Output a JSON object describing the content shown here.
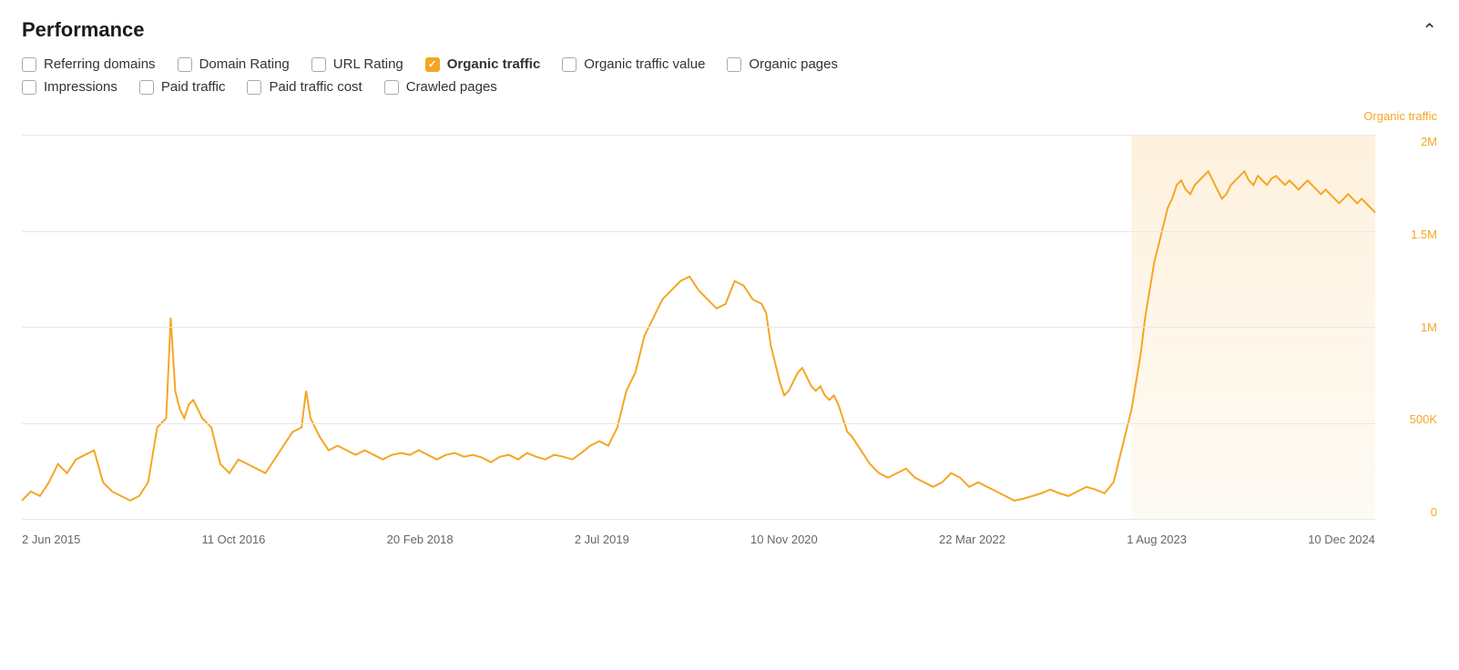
{
  "header": {
    "title": "Performance",
    "collapse_icon": "chevron-up"
  },
  "filters": {
    "row1": [
      {
        "id": "referring_domains",
        "label": "Referring domains",
        "checked": false
      },
      {
        "id": "domain_rating",
        "label": "Domain Rating",
        "checked": false
      },
      {
        "id": "url_rating",
        "label": "URL Rating",
        "checked": false
      },
      {
        "id": "organic_traffic",
        "label": "Organic traffic",
        "checked": true
      },
      {
        "id": "organic_traffic_value",
        "label": "Organic traffic value",
        "checked": false
      },
      {
        "id": "organic_pages",
        "label": "Organic pages",
        "checked": false
      }
    ],
    "row2": [
      {
        "id": "impressions",
        "label": "Impressions",
        "checked": false
      },
      {
        "id": "paid_traffic",
        "label": "Paid traffic",
        "checked": false
      },
      {
        "id": "paid_traffic_cost",
        "label": "Paid traffic cost",
        "checked": false
      },
      {
        "id": "crawled_pages",
        "label": "Crawled pages",
        "checked": false
      }
    ]
  },
  "chart": {
    "legend_label": "Organic traffic",
    "y_labels": [
      "2M",
      "1.5M",
      "1M",
      "500K",
      "0"
    ],
    "x_labels": [
      "2 Jun 2015",
      "11 Oct 2016",
      "20 Feb 2018",
      "2 Jul 2019",
      "10 Nov 2020",
      "22 Mar 2022",
      "1 Aug 2023",
      "10 Dec 2024"
    ],
    "accent_color": "#f5a623"
  }
}
